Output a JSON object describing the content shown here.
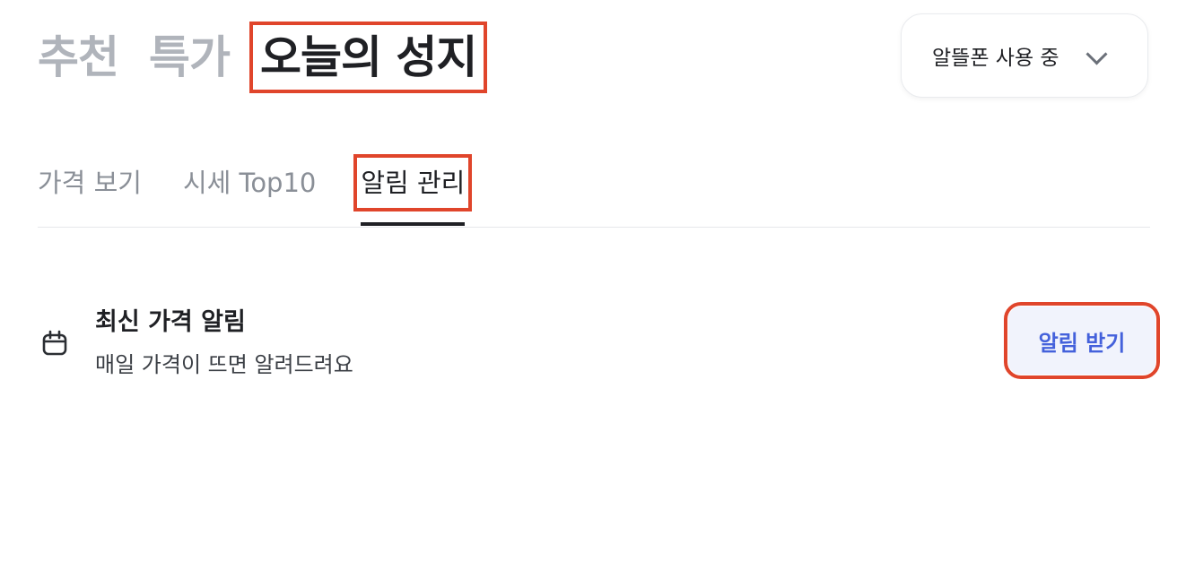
{
  "top_tabs": [
    {
      "label": "추천",
      "active": false
    },
    {
      "label": "특가",
      "active": false
    },
    {
      "label": "오늘의 성지",
      "active": true
    }
  ],
  "carrier_selector": {
    "label": "알뜰폰 사용 중",
    "icon": "chevron-down-icon"
  },
  "sub_tabs": [
    {
      "label": "가격 보기",
      "active": false
    },
    {
      "label": "시세 Top10",
      "active": false
    },
    {
      "label": "알림 관리",
      "active": true
    }
  ],
  "alert": {
    "icon": "calendar-icon",
    "title": "최신 가격 알림",
    "description": "매일 가격이 뜨면 알려드려요",
    "button_label": "알림 받기"
  },
  "colors": {
    "highlight_box": "#e0452b",
    "accent": "#4461db",
    "inactive_text": "#b0b4bb"
  }
}
